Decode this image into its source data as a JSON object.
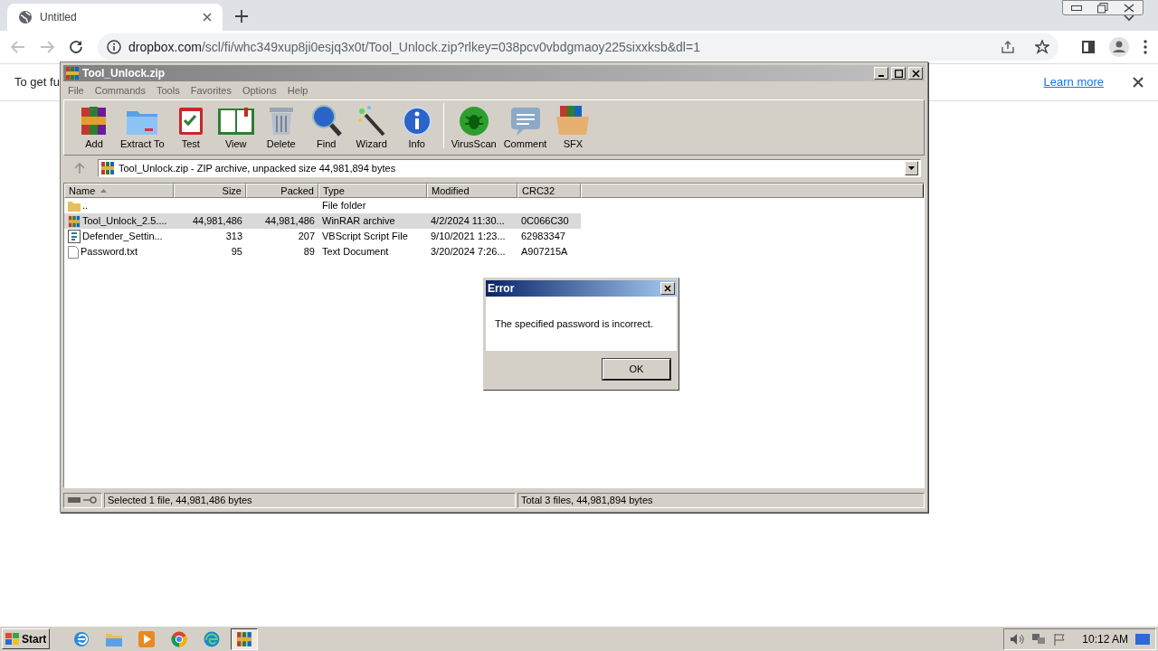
{
  "browser": {
    "tabs": [
      {
        "title": "Untitled",
        "selected": true
      }
    ],
    "url": {
      "host": "dropbox.com",
      "path": "/scl/fi/whc349xup8ji0esjq3x0t/Tool_Unlock.zip?rlkey=038pcv0vbdgmaoy225sixxksb&dl=1"
    },
    "infobar": {
      "text": "To get fu",
      "link": "Learn more"
    }
  },
  "winrar": {
    "title": "Tool_Unlock.zip",
    "menu": [
      "File",
      "Commands",
      "Tools",
      "Favorites",
      "Options",
      "Help"
    ],
    "toolbar": [
      "Add",
      "Extract To",
      "Test",
      "View",
      "Delete",
      "Find",
      "Wizard",
      "Info",
      "VirusScan",
      "Comment",
      "SFX"
    ],
    "address": "Tool_Unlock.zip - ZIP archive, unpacked size 44,981,894 bytes",
    "columns": [
      "Name",
      "Size",
      "Packed",
      "Type",
      "Modified",
      "CRC32"
    ],
    "rows": [
      {
        "kind": "folder",
        "name": "..",
        "size": "",
        "packed": "",
        "type": "File folder",
        "modified": "",
        "crc": "",
        "selected": false
      },
      {
        "kind": "archive",
        "name": "Tool_Unlock_2.5....",
        "size": "44,981,486",
        "packed": "44,981,486",
        "type": "WinRAR archive",
        "modified": "4/2/2024 11:30...",
        "crc": "0C066C30",
        "selected": true
      },
      {
        "kind": "script",
        "name": "Defender_Settin...",
        "size": "313",
        "packed": "207",
        "type": "VBScript Script File",
        "modified": "9/10/2021 1:23...",
        "crc": "62983347",
        "selected": false
      },
      {
        "kind": "text",
        "name": "Password.txt",
        "size": "95",
        "packed": "89",
        "type": "Text Document",
        "modified": "3/20/2024 7:26...",
        "crc": "A907215A",
        "selected": false
      }
    ],
    "status": [
      "Selected 1 file, 44,981,486 bytes",
      "Total 3 files, 44,981,894 bytes"
    ]
  },
  "dialog": {
    "title": "Error",
    "message": "The specified password is incorrect.",
    "button": "OK"
  },
  "taskbar": {
    "start": "Start",
    "apps": [
      {
        "kind": "ie",
        "selected": false
      },
      {
        "kind": "explorer",
        "selected": false
      },
      {
        "kind": "media",
        "selected": false
      },
      {
        "kind": "chrome",
        "selected": false
      },
      {
        "kind": "edge",
        "selected": false
      },
      {
        "kind": "winrar",
        "selected": true
      }
    ],
    "clock": "10:12 AM"
  }
}
